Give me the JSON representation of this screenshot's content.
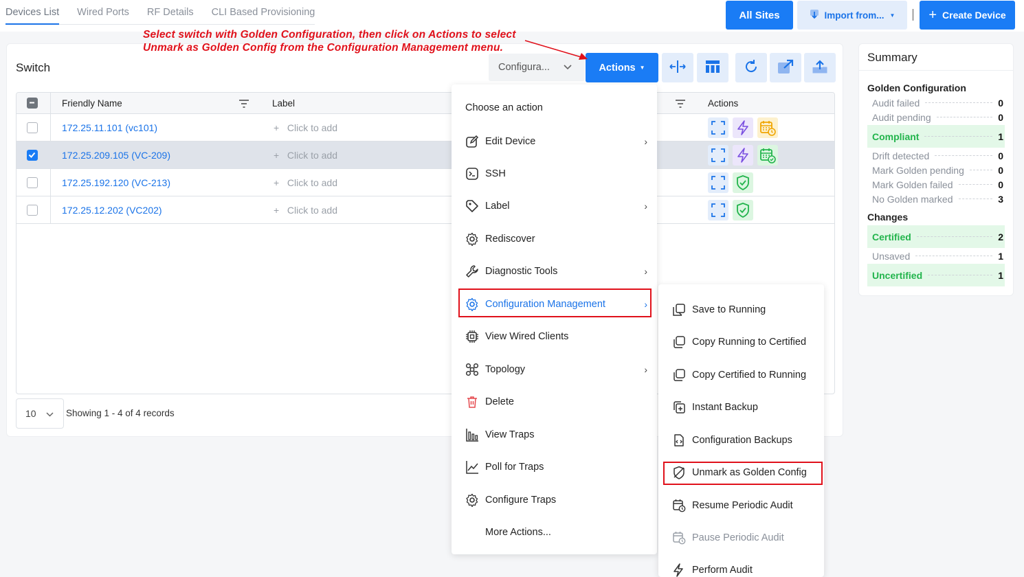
{
  "tabs": [
    "Devices List",
    "Wired Ports",
    "RF Details",
    "CLI Based Provisioning"
  ],
  "header": {
    "all_sites": "All Sites",
    "import_from": "Import from...",
    "create_device": "Create Device"
  },
  "annotation": {
    "line1": "Select switch with Golden Configuration, then click on Actions to select",
    "line2": "Unmark as Golden Config from the Configuration Management menu."
  },
  "card": {
    "title": "Switch",
    "filter_select": "Configura...",
    "actions_label": "Actions",
    "toolbar_icons": [
      "split-horizontal-icon",
      "columns-icon",
      "refresh-icon",
      "open-external-icon",
      "upload-icon"
    ]
  },
  "table": {
    "columns": [
      "Friendly Name",
      "Label",
      "Actions"
    ],
    "rows": [
      {
        "name": "172.25.11.101 (vc101)",
        "label": "Click to add",
        "selected": false,
        "icons": [
          "expand-icon",
          "bolt-icon",
          "calendar-pending-icon"
        ]
      },
      {
        "name": "172.25.209.105 (VC-209)",
        "label": "Click to add",
        "selected": true,
        "icons": [
          "expand-icon",
          "bolt-icon",
          "calendar-check-icon"
        ]
      },
      {
        "name": "172.25.192.120 (VC-213)",
        "label": "Click to add",
        "selected": false,
        "icons": [
          "expand-icon",
          "shield-check-icon"
        ]
      },
      {
        "name": "172.25.12.202 (VC202)",
        "label": "Click to add",
        "selected": false,
        "icons": [
          "expand-icon",
          "shield-check-icon"
        ]
      }
    ]
  },
  "pager": {
    "page_size": "10",
    "showing": "Showing 1 - 4 of 4 records"
  },
  "summary": {
    "title": "Summary",
    "golden_title": "Golden Configuration",
    "golden": [
      {
        "label": "Audit failed",
        "value": "0"
      },
      {
        "label": "Audit pending",
        "value": "0"
      },
      {
        "label": "Compliant",
        "value": "1"
      },
      {
        "label": "Drift detected",
        "value": "0"
      },
      {
        "label": "Mark Golden pending",
        "value": "0"
      },
      {
        "label": "Mark Golden failed",
        "value": "0"
      },
      {
        "label": "No Golden marked",
        "value": "3"
      }
    ],
    "changes_title": "Changes",
    "changes": [
      {
        "label": "Certified",
        "value": "2"
      },
      {
        "label": "Unsaved",
        "value": "1"
      },
      {
        "label": "Uncertified",
        "value": "1"
      }
    ]
  },
  "menu": {
    "heading": "Choose an action",
    "items": [
      "Edit Device",
      "SSH",
      "Label",
      "Rediscover",
      "Diagnostic Tools",
      "Configuration Management",
      "View Wired Clients",
      "Topology",
      "Delete",
      "View Traps",
      "Poll for Traps",
      "Configure Traps",
      "More Actions..."
    ]
  },
  "submenu": {
    "items": [
      "Save to Running",
      "Copy Running to Certified",
      "Copy Certified to Running",
      "Instant Backup",
      "Configuration Backups",
      "Unmark as Golden Config",
      "Resume Periodic Audit",
      "Pause Periodic Audit",
      "Perform Audit"
    ]
  },
  "colors": {
    "primary": "#1a7cf5",
    "link": "#1a73e8",
    "success": "#22b44c",
    "annotation": "#e0101a"
  }
}
